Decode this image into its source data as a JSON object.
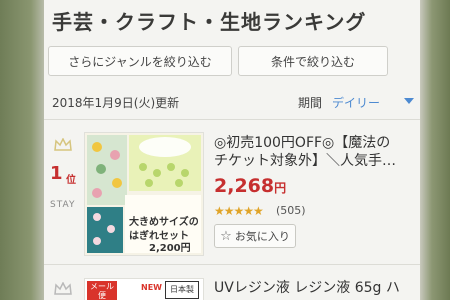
{
  "page": {
    "title": "手芸・クラフト・生地ランキング"
  },
  "filters": {
    "genre_button": "さらにジャンルを絞り込む",
    "condition_button": "条件で絞り込む"
  },
  "info": {
    "updated": "2018年1月9日(火)更新",
    "period_label": "期間",
    "period_value": "デイリー"
  },
  "ranking": [
    {
      "rank_number": "1",
      "rank_unit": "位",
      "status": "STAY",
      "title_line1": "◎初売100円OFF◎【魔法の",
      "title_line2": "チケット対象外】＼人気手…",
      "price": "2,268",
      "price_unit": "円",
      "stars": "★★★★★",
      "rating": 4.5,
      "reviews": "(505)",
      "favorite_label": "お気に入り",
      "thumb_text_1": "大きめサイズの",
      "thumb_text_2": "はぎれセット",
      "thumb_price": "2,200",
      "thumb_price_unit": "円"
    },
    {
      "title": "UVレジン液 レジン液 65g ハ",
      "thumb_badge_1": "メール便",
      "thumb_badge_2": "送料",
      "thumb_badge_3": "NEW",
      "thumb_badge_4": "日本製"
    }
  ],
  "colors": {
    "accent_blue": "#4d8ad1",
    "price_red": "#c62f2f",
    "star_gold": "#e0a428"
  }
}
